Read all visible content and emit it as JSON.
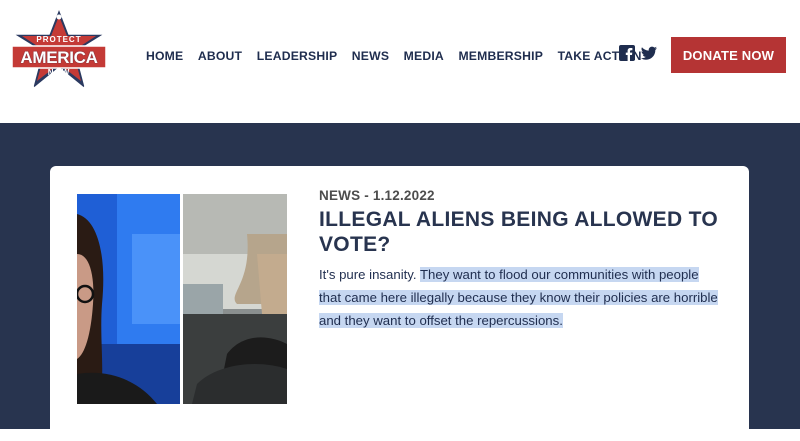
{
  "logo": {
    "top_text": "PROTECT",
    "main_text": "AMERICA",
    "bottom_text": "NOW",
    "colors": {
      "navy": "#2a3960",
      "red": "#c43a36",
      "white": "#ffffff"
    }
  },
  "nav": {
    "items": [
      {
        "label": "HOME"
      },
      {
        "label": "ABOUT"
      },
      {
        "label": "LEADERSHIP"
      },
      {
        "label": "NEWS"
      },
      {
        "label": "MEDIA"
      },
      {
        "label": "MEMBERSHIP"
      },
      {
        "label": "TAKE ACTION"
      }
    ]
  },
  "social": {
    "icons": [
      "facebook-icon",
      "twitter-icon"
    ]
  },
  "donate": {
    "label": "DONATE NOW",
    "color": "#b53434"
  },
  "article": {
    "meta": "NEWS - 1.12.2022",
    "title": "ILLEGAL ALIENS BEING ALLOWED TO VOTE?",
    "excerpt_plain": "It's pure insanity. ",
    "excerpt_highlighted": "They want to flood our communities with people that came here illegally because they know their policies are horrible and they want to offset the repercussions."
  },
  "colors": {
    "band": "#28344f",
    "nav_text": "#1f2d4e",
    "highlight": "#c6d7f1"
  }
}
